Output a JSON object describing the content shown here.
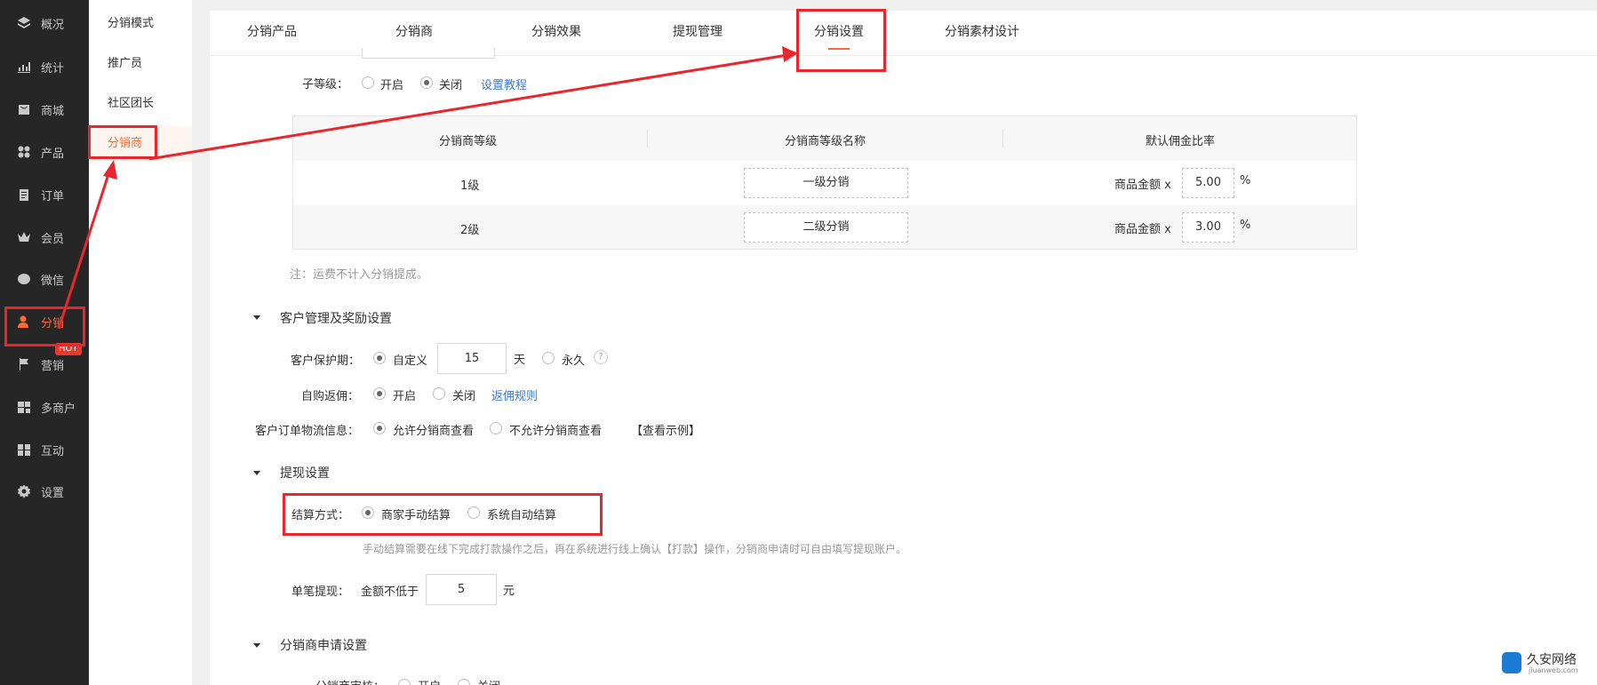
{
  "left_nav": [
    {
      "label": "概况",
      "icon": "layers-icon"
    },
    {
      "label": "统计",
      "icon": "chart-icon"
    },
    {
      "label": "商城",
      "icon": "store-icon"
    },
    {
      "label": "产品",
      "icon": "grid-icon"
    },
    {
      "label": "订单",
      "icon": "order-icon"
    },
    {
      "label": "会员",
      "icon": "crown-icon"
    },
    {
      "label": "微信",
      "icon": "wechat-icon"
    },
    {
      "label": "分销",
      "icon": "user-icon",
      "active": true
    },
    {
      "label": "营销",
      "icon": "flag-icon"
    },
    {
      "label": "多商户",
      "icon": "merchant-icon"
    },
    {
      "label": "互动",
      "icon": "interact-icon"
    },
    {
      "label": "设置",
      "icon": "gear-icon"
    }
  ],
  "hot_badge": "HOT",
  "sub_nav": [
    {
      "label": "分销模式"
    },
    {
      "label": "推广员"
    },
    {
      "label": "社区团长"
    },
    {
      "label": "分销商",
      "active": true
    }
  ],
  "tabs": [
    {
      "label": "分销产品"
    },
    {
      "label": "分销商"
    },
    {
      "label": "分销效果"
    },
    {
      "label": "提现管理"
    },
    {
      "label": "分销设置",
      "active": true
    },
    {
      "label": "分销素材设计"
    }
  ],
  "sub_level": {
    "label": "子等级：",
    "option_on": "开启",
    "option_off": "关闭",
    "selected": "关闭",
    "tutorial_link": "设置教程"
  },
  "level_table": {
    "headers": [
      "分销商等级",
      "分销商等级名称",
      "默认佣金比率"
    ],
    "rows": [
      {
        "level": "1级",
        "name": "一级分销",
        "prefix": "商品金额 x",
        "rate": "5.00",
        "unit": "%"
      },
      {
        "level": "2级",
        "name": "二级分销",
        "prefix": "商品金额 x",
        "rate": "3.00",
        "unit": "%"
      }
    ]
  },
  "note": "注：运费不计入分销提成。",
  "customer_section": {
    "title": "客户管理及奖励设置",
    "protection": {
      "label": "客户保护期：",
      "custom": "自定义",
      "days": "15",
      "day_unit": "天",
      "forever": "永久",
      "help": "?"
    },
    "self_rebate": {
      "label": "自购返佣：",
      "on": "开启",
      "off": "关闭",
      "rule_link": "返佣规则"
    },
    "logistics": {
      "label": "客户订单物流信息：",
      "allow": "允许分销商查看",
      "deny": "不允许分销商查看",
      "example": "【查看示例】"
    }
  },
  "withdraw_section": {
    "title": "提现设置",
    "settle": {
      "label": "结算方式：",
      "manual": "商家手动结算",
      "auto": "系统自动结算"
    },
    "hint": "手动结算需要在线下完成打款操作之后，再在系统进行线上确认【打款】操作，分销商申请时可自由填写提现账户。",
    "single": {
      "label": "单笔提现：",
      "prefix": "金额不低于",
      "value": "5",
      "unit": "元"
    }
  },
  "apply_section": {
    "title": "分销商申请设置",
    "partial_label": "分销商审核：",
    "on": "开启",
    "off": "关闭"
  },
  "watermark": {
    "name": "久安网络",
    "url": "jiuanweb.com"
  },
  "colors": {
    "accent": "#ff6a33",
    "annotation": "#e8262d",
    "sidebar": "#262626",
    "link": "#3a7bd5"
  }
}
